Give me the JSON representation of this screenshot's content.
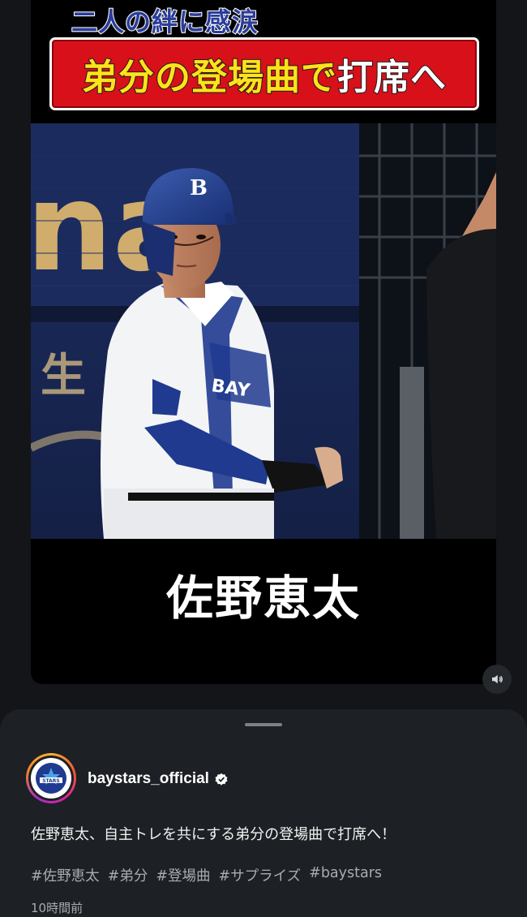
{
  "video": {
    "headline_top": "二人の絆に感涙",
    "headline_banner_main": "弟分の登場曲で",
    "headline_banner_end": "打席へ",
    "player_name": "佐野恵太",
    "scoreboard_text": "na",
    "wall_text": "生"
  },
  "post": {
    "username": "baystars_official",
    "caption": "佐野恵太、自主トレを共にする弟分の登場曲で打席へ！",
    "hashtags": [
      "#佐野恵太",
      "#弟分",
      "#登場曲",
      "#サプライズ",
      "#baystars"
    ],
    "timestamp": "10時間前"
  },
  "icons": {
    "sound": "speaker-icon",
    "verified": "verified-badge-icon"
  },
  "colors": {
    "banner_red": "#d8101a",
    "banner_yellow": "#ffe21a",
    "team_blue": "#1f3a8f",
    "background": "#131518",
    "sheet": "#1d2024"
  }
}
